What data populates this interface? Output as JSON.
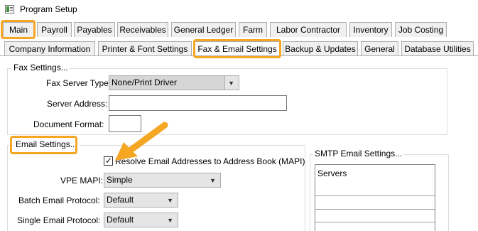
{
  "window": {
    "title": "Program Setup",
    "icon": "app-window-icon"
  },
  "tabs_row1": [
    {
      "label": "Main"
    },
    {
      "label": "Payroll"
    },
    {
      "label": "Payables"
    },
    {
      "label": "Receivables"
    },
    {
      "label": "General Ledger"
    },
    {
      "label": "Farm"
    },
    {
      "label": "Labor Contractor"
    },
    {
      "label": "Inventory"
    },
    {
      "label": "Job Costing"
    }
  ],
  "tabs_row2": [
    {
      "label": "Company Information"
    },
    {
      "label": "Printer & Font Settings"
    },
    {
      "label": "Fax & Email Settings",
      "selected": true
    },
    {
      "label": "Backup & Updates"
    },
    {
      "label": "General"
    },
    {
      "label": "Database Utilities"
    }
  ],
  "fax": {
    "group_label": "Fax Settings...",
    "server_type_label": "Fax Server Type:",
    "server_type_value": "None/Print Driver",
    "server_address_label": "Server Address:",
    "server_address_value": "",
    "doc_format_label": "Document Format:",
    "doc_format_value": ""
  },
  "email": {
    "group_label": "Email Settings...",
    "resolve_label": "Resolve Email Addresses to Address Book (MAPI)",
    "resolve_checked": true,
    "vpe_mapi_label": "VPE MAPI:",
    "vpe_mapi_value": "Simple",
    "batch_label": "Batch Email Protocol:",
    "batch_value": "Default",
    "single_label": "Single Email Protocol:",
    "single_value": "Default"
  },
  "smtp": {
    "group_label": "SMTP Email Settings...",
    "list_header": "Servers"
  },
  "colors": {
    "highlight": "#f5a623",
    "tab_bg": "#f0f0f0",
    "border": "#adadad"
  }
}
